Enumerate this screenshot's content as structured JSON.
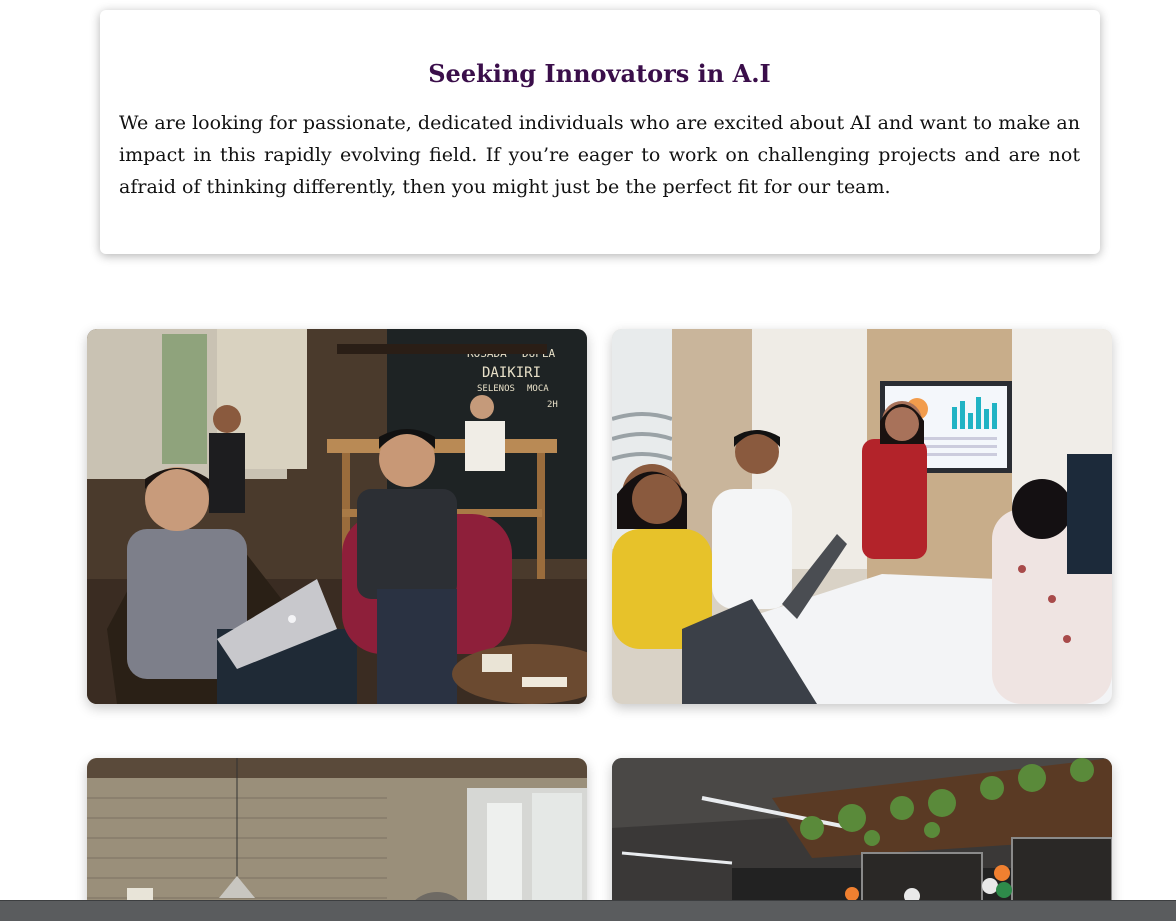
{
  "hero_card": {
    "title": "Seeking Innovators in A.I",
    "body": "We are looking for passionate, dedicated individuals who are excited about AI and want to make an impact in this rapidly evolving field. If you’re eager to work on challenging projects and are not afraid of thinking differently, then you might just be the perfect fit for our team."
  },
  "gallery": {
    "cafe_sign_lines": [
      "ROSADA",
      "DUPLA",
      "DAIKIRI",
      "SELENOS",
      "MOCA",
      "2H"
    ]
  },
  "colors": {
    "title": "#3a0e4a",
    "body_text": "#111111",
    "bottom_bar": "#5a5c5e"
  }
}
